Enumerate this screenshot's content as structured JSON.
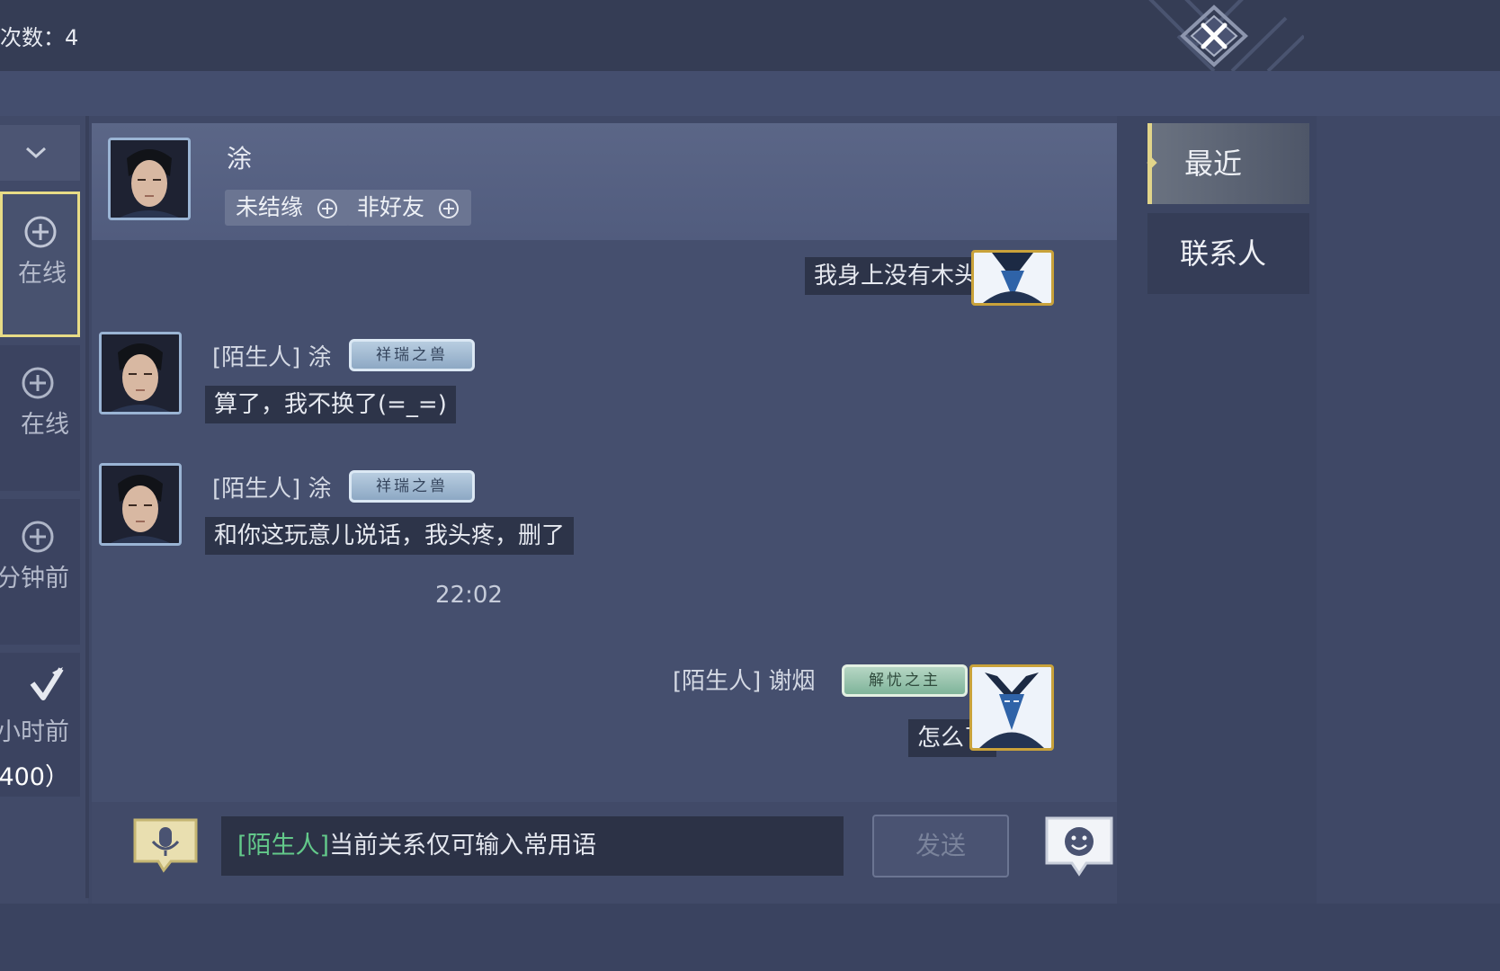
{
  "header": {
    "counter_text": "次数：4"
  },
  "contact_list": {
    "items": [
      {
        "label": "在线",
        "icon": "plus-circle-icon",
        "selected": true
      },
      {
        "label": "在线",
        "icon": "plus-circle-icon",
        "selected": false
      },
      {
        "label": "分钟前",
        "icon": "plus-circle-icon",
        "selected": false
      },
      {
        "label": "小时前",
        "extra": "400）",
        "icon": "brush-icon",
        "selected": false
      }
    ]
  },
  "chat": {
    "title": "涂",
    "tags": [
      {
        "label": "未结缘"
      },
      {
        "label": "非好友"
      }
    ],
    "messages": [
      {
        "side": "right",
        "text": "我身上没有木头"
      },
      {
        "side": "left",
        "sender": "[陌生人] 涂",
        "badge": "祥瑞之兽",
        "text": "算了，我不换了(=_=)"
      },
      {
        "side": "left",
        "sender": "[陌生人] 涂",
        "badge": "祥瑞之兽",
        "text": "和你这玩意儿说话，我头疼，删了"
      },
      {
        "side": "right",
        "sender": "[陌生人] 谢烟",
        "badge": "解忧之主",
        "text": "怎么了"
      }
    ],
    "timestamp": "22:02",
    "input": {
      "prefix": "[陌生人]",
      "text": "当前关系仅可输入常用语"
    },
    "send_label": "发送"
  },
  "tabs": [
    {
      "label": "最近",
      "active": true
    },
    {
      "label": "联系人",
      "active": false
    }
  ],
  "colors": {
    "background": "#3f4866",
    "selected_border": "#e8dc86",
    "input_prefix": "#63c98a",
    "bubble": "#2d3449"
  }
}
